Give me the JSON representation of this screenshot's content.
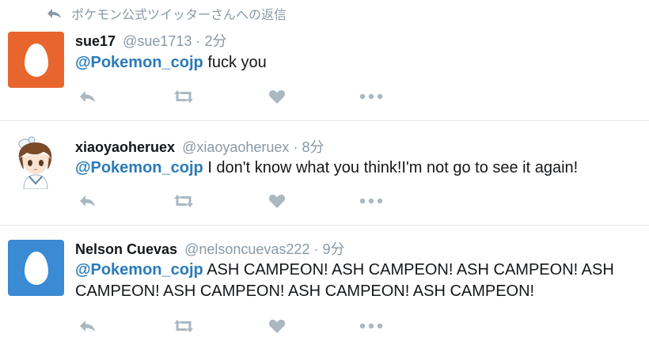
{
  "context": {
    "label": "ポケモン公式ツイッターさんへの返信"
  },
  "tweets": [
    {
      "name": "sue17",
      "handle": "@sue1713",
      "dot": "·",
      "time": "2分",
      "mention": "@Pokemon_cojp",
      "text": " fuck you",
      "avatar": "egg",
      "avatar_color": "#e8662e"
    },
    {
      "name": "xiaoyaoheruex",
      "handle": "@xiaoyaoheruex",
      "dot": "·",
      "time": "8分",
      "mention": "@Pokemon_cojp",
      "text": " I don't know what you think!I'm not go to see it again!",
      "avatar": "anime-character"
    },
    {
      "name": "Nelson Cuevas",
      "handle": "@nelsoncuevas222",
      "dot": "·",
      "time": "9分",
      "mention": "@Pokemon_cojp",
      "text": " ASH CAMPEON! ASH CAMPEON! ASH CAMPEON! ASH CAMPEON! ASH CAMPEON! ASH CAMPEON! ASH CAMPEON!",
      "avatar": "egg",
      "avatar_color": "#3a8ad4"
    }
  ],
  "icons": {
    "reply": "reply-icon",
    "retweet": "retweet-icon",
    "like": "heart-icon",
    "more": "more-icon"
  },
  "colors": {
    "accent": "#2b7bb9",
    "muted": "#8899a6",
    "action": "#aab8c2",
    "divider": "#e1e8ed"
  }
}
